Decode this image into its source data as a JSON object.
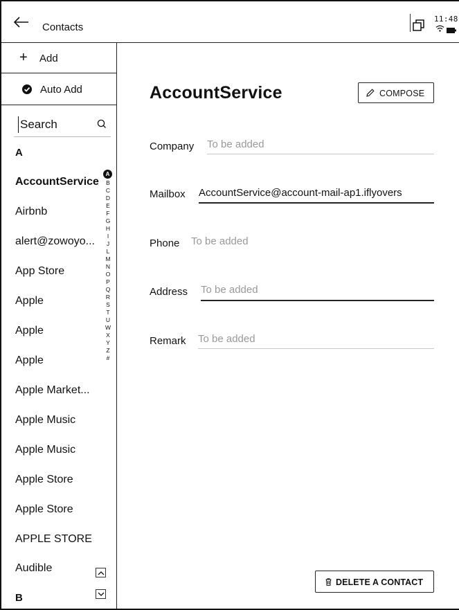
{
  "header": {
    "title": "Contacts",
    "clock": "11:48"
  },
  "sidebar": {
    "add_label": "Add",
    "auto_add_label": "Auto Add",
    "search_value": "Search",
    "sections": {
      "A": "A",
      "B": "B"
    },
    "contacts": [
      "AccountService",
      "Airbnb",
      "alert@zowoyo...",
      "App Store",
      "Apple",
      "Apple",
      "Apple",
      "Apple Market...",
      "Apple Music",
      "Apple Music",
      "Apple Store",
      "Apple Store",
      "APPLE STORE",
      "Audible"
    ],
    "selected_index": 0,
    "alphabet": [
      "A",
      "B",
      "C",
      "D",
      "E",
      "F",
      "G",
      "H",
      "I",
      "J",
      "L",
      "M",
      "N",
      "O",
      "P",
      "Q",
      "R",
      "S",
      "T",
      "U",
      "W",
      "X",
      "Y",
      "Z",
      "#"
    ],
    "active_letter": "A"
  },
  "detail": {
    "name": "AccountService",
    "compose_label": "COMPOSE",
    "fields": {
      "company": {
        "label": "Company",
        "value": "To be added"
      },
      "mailbox": {
        "label": "Mailbox",
        "value": "AccountService@account-mail-ap1.iflyovers"
      },
      "phone": {
        "label": "Phone",
        "value": "To be added"
      },
      "address": {
        "label": "Address",
        "value": "To be added"
      },
      "remark": {
        "label": "Remark",
        "value": "To be added"
      }
    },
    "delete_label": "DELETE A CONTACT"
  },
  "icons": {
    "back": "arrow-left-icon",
    "windows": "windows-icon",
    "wifi": "wifi-icon",
    "battery": "battery-icon",
    "add": "plus-icon",
    "auto_add": "check-circle-icon",
    "search": "search-icon",
    "compose": "pencil-icon",
    "delete": "trash-icon",
    "scroll_up": "chevron-up-icon",
    "scroll_down": "chevron-down-icon"
  }
}
